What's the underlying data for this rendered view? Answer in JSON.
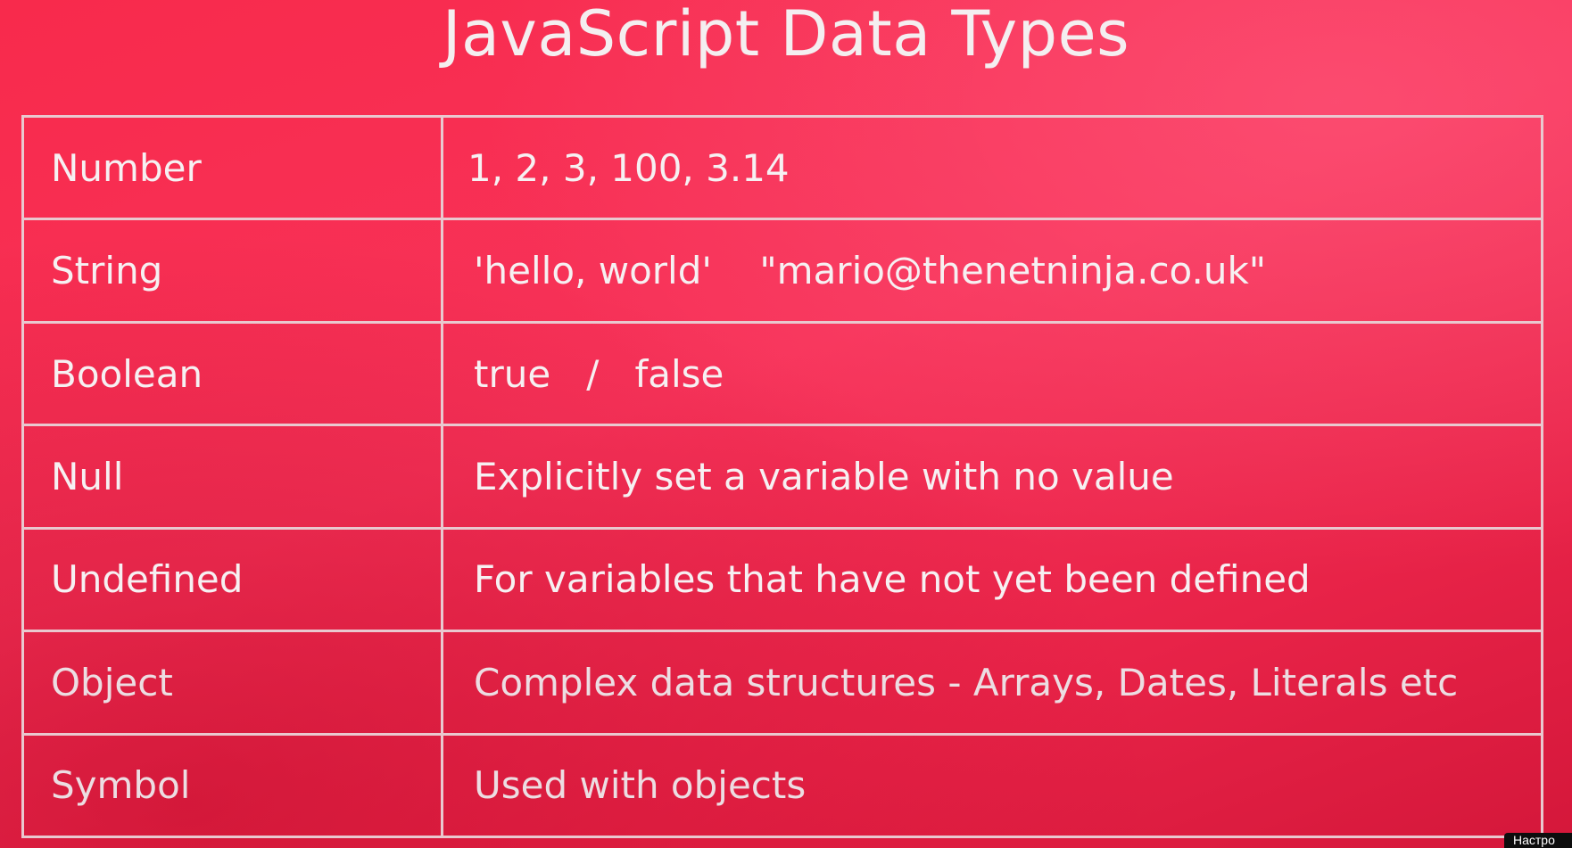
{
  "title": "JavaScript Data Types",
  "rows": [
    {
      "type": "Number",
      "value": "1, 2, 3, 100, 3.14"
    },
    {
      "type": "String",
      "value": "'hello, world'    \"mario@thenetninja.co.uk\""
    },
    {
      "type": "Boolean",
      "value": "true   /   false"
    },
    {
      "type": "Null",
      "value": "Explicitly set a variable with no value"
    },
    {
      "type": "Undefined",
      "value": "For variables that have not yet been defined"
    },
    {
      "type": "Object",
      "value": "Complex data structures - Arrays, Dates, Literals etc"
    },
    {
      "type": "Symbol",
      "value": "Used with objects"
    }
  ],
  "corner_label": "Настро",
  "colors": {
    "background": "#f7335a",
    "table_border": "#e9c8cf",
    "text": "#f6f0f2"
  }
}
